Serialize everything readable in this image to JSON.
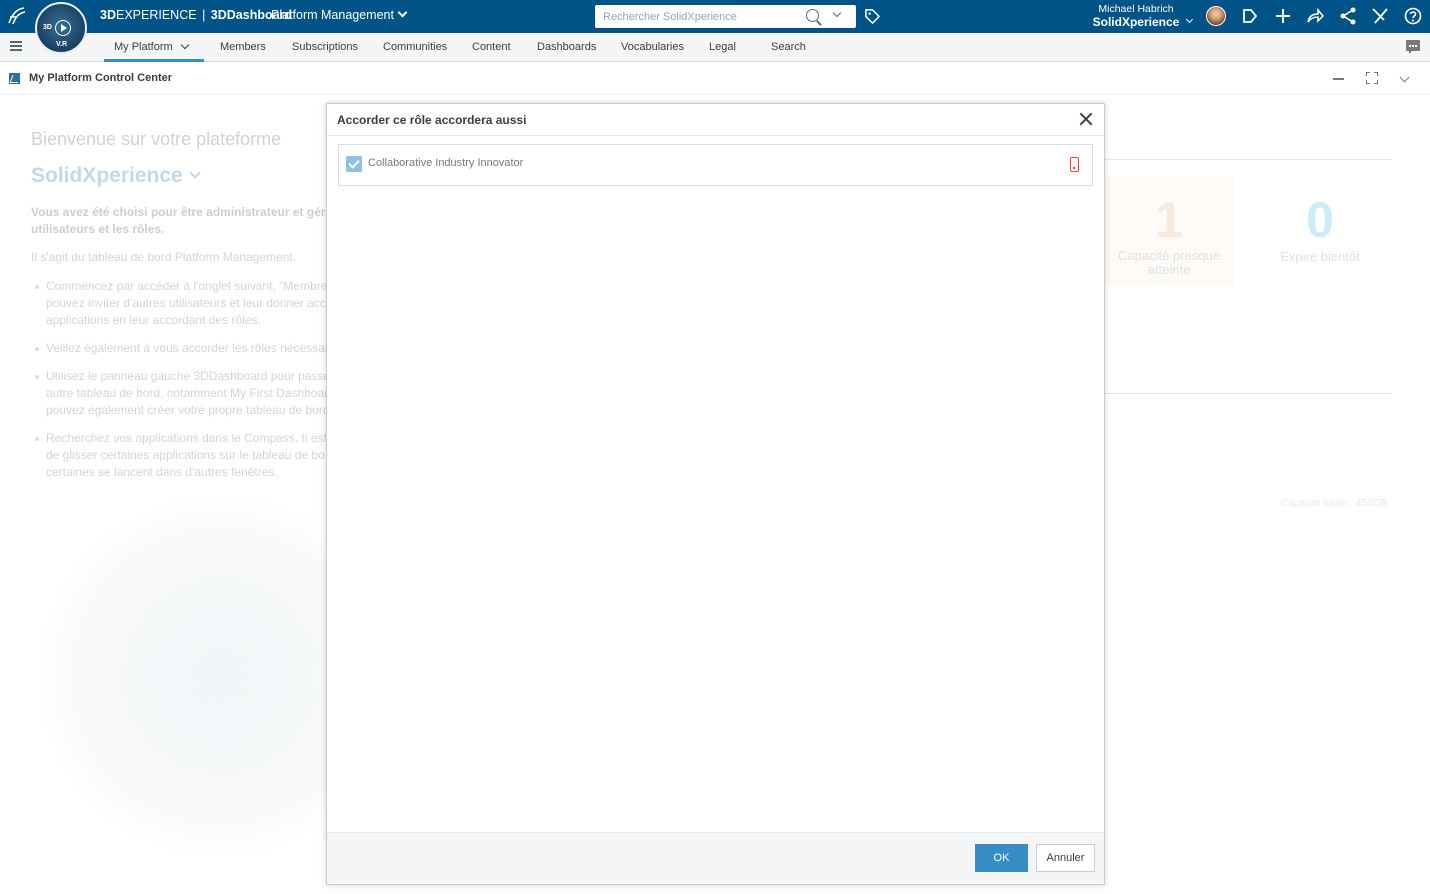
{
  "topbar": {
    "brand_prefix": "3D",
    "brand_main": "EXPERIENCE",
    "brand_sep": "|",
    "brand_product_prefix": "3D",
    "brand_product": "Dashboard",
    "app_title": "Platform Management",
    "search_placeholder": "Rechercher SolidXperience",
    "user_name": "Michael Habrich",
    "user_org": "SolidXperience",
    "compass_label": "V.R",
    "compass_3d": "3D",
    "icons": [
      "ds-logo-icon",
      "compass-icon",
      "search-icon",
      "chevron-down-icon",
      "tag-icon",
      "avatar",
      "tag-outline-icon",
      "plus-icon",
      "share-icon",
      "network-share-icon",
      "tools-icon",
      "help-icon"
    ]
  },
  "tabs": [
    {
      "label": "My Platform",
      "active": true
    },
    {
      "label": "Members"
    },
    {
      "label": "Subscriptions"
    },
    {
      "label": "Communities"
    },
    {
      "label": "Content"
    },
    {
      "label": "Dashboards"
    },
    {
      "label": "Vocabularies"
    },
    {
      "label": "Legal"
    },
    {
      "label": "Search"
    }
  ],
  "widget": {
    "title": "My Platform Control Center"
  },
  "background": {
    "welcome": "Bienvenue sur votre plateforme",
    "org": "SolidXperience",
    "intro_bold_line1": "Vous avez été choisi pour être administrateur et gér",
    "intro_bold_line2": "utilisateurs et les rôles.",
    "intro": "Il s'agit du tableau de bord Platform Management.",
    "bullets": [
      [
        "Commencez par accéder à l'onglet suivant, \"Membre",
        "pouvez inviter d'autres utilisateurs et leur donner acc",
        "applications en leur accordant des rôles."
      ],
      [
        "Veillez également à vous accorder les rôles nécessai"
      ],
      [
        "Utilisez le panneau gauche 3DDashboard pour passe",
        "autre tableau de bord, notamment My First Dashboar",
        "pouvez également créer votre propre tableau de bord"
      ],
      [
        "Recherchez vos applications dans le Compass. Il est",
        "de glisser certaines applications sur le tableau de bo",
        "certaines se lancent dans d'autres fenêtres."
      ]
    ],
    "stat1_value": "1",
    "stat1_label_line1": "Capacité presque",
    "stat1_label_line2": "atteinte",
    "stat2_value": "0",
    "stat2_label": "Expire bientôt",
    "capacity": "Capacité totale : 450GB"
  },
  "modal": {
    "title": "Accorder ce rôle accordera aussi",
    "role_name": "Collaborative Industry Innovator",
    "role_checked": true,
    "ok_label": "OK",
    "cancel_label": "Annuler"
  },
  "colors": {
    "topbar": "#005386",
    "accent": "#368ec4",
    "warning": "#e6473a"
  }
}
